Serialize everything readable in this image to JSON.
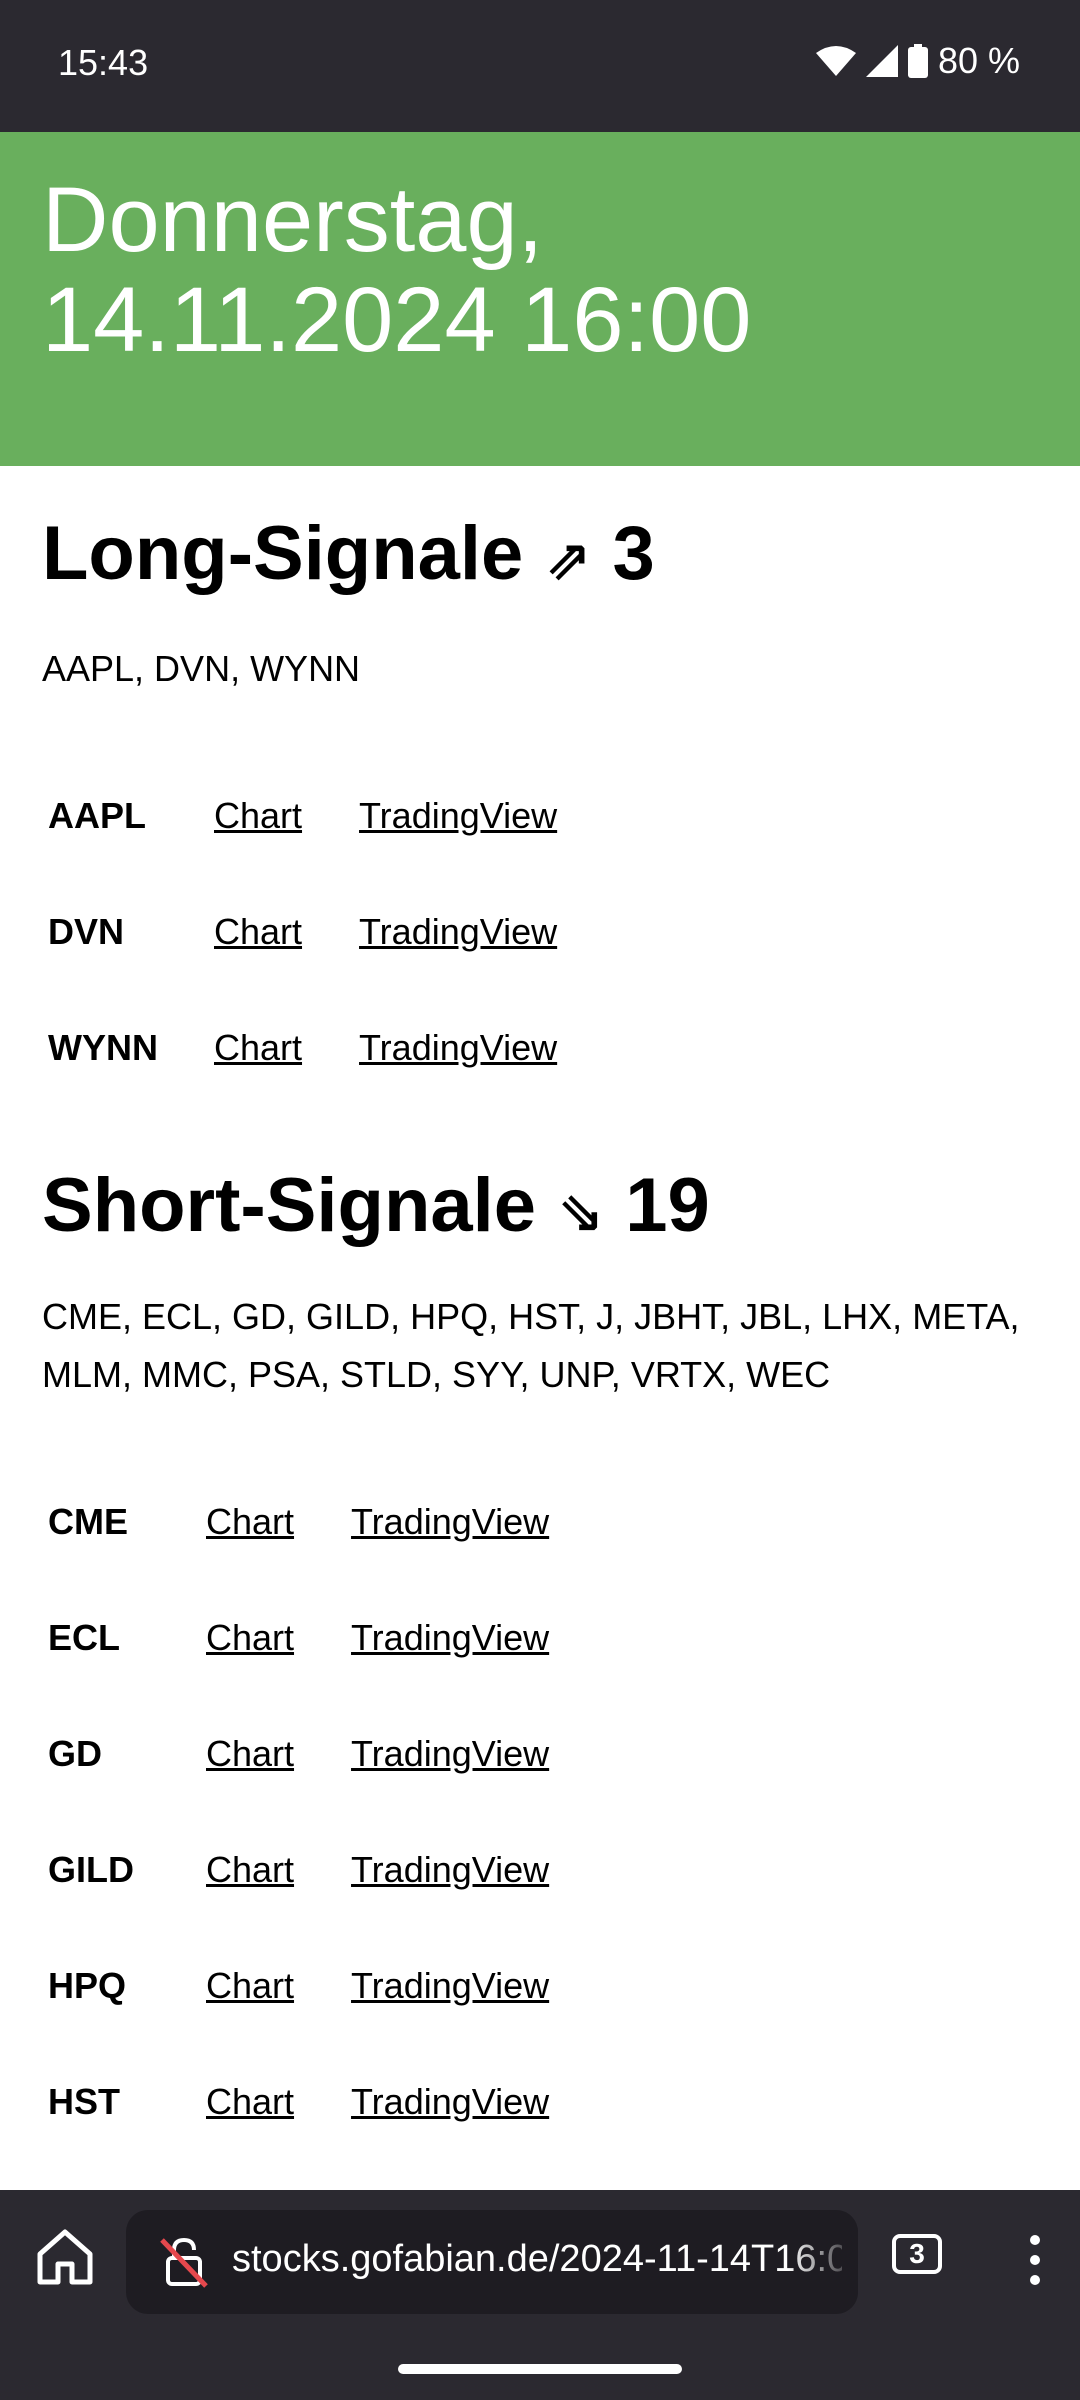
{
  "status_bar": {
    "time": "15:43",
    "battery": "80 %",
    "icons": [
      "wifi-icon",
      "signal-icon",
      "battery-icon"
    ]
  },
  "header": {
    "line1": "Donnerstag,",
    "line2": "14.11.2024 16:00",
    "background_color": "#69af5d"
  },
  "long": {
    "title": "Long-Signale",
    "arrow": "⇗",
    "count": "3",
    "symbols_text": "AAPL, DVN, WYNN",
    "rows": [
      {
        "symbol": "AAPL",
        "chart": "Chart",
        "tv": "TradingView"
      },
      {
        "symbol": "DVN",
        "chart": "Chart",
        "tv": "TradingView"
      },
      {
        "symbol": "WYNN",
        "chart": "Chart",
        "tv": "TradingView"
      }
    ]
  },
  "short": {
    "title": "Short-Signale",
    "arrow": "⇘",
    "count": "19",
    "symbols_text": "CME, ECL, GD, GILD, HPQ, HST, J, JBHT, JBL, LHX, META, MLM, MMC, PSA, STLD, SYY, UNP, VRTX, WEC",
    "rows": [
      {
        "symbol": "CME",
        "chart": "Chart",
        "tv": "TradingView"
      },
      {
        "symbol": "ECL",
        "chart": "Chart",
        "tv": "TradingView"
      },
      {
        "symbol": "GD",
        "chart": "Chart",
        "tv": "TradingView"
      },
      {
        "symbol": "GILD",
        "chart": "Chart",
        "tv": "TradingView"
      },
      {
        "symbol": "HPQ",
        "chart": "Chart",
        "tv": "TradingView"
      },
      {
        "symbol": "HST",
        "chart": "Chart",
        "tv": "TradingView"
      }
    ]
  },
  "browser": {
    "url": "stocks.gofabian.de/2024-11-14T16:00",
    "tab_count": "3"
  }
}
